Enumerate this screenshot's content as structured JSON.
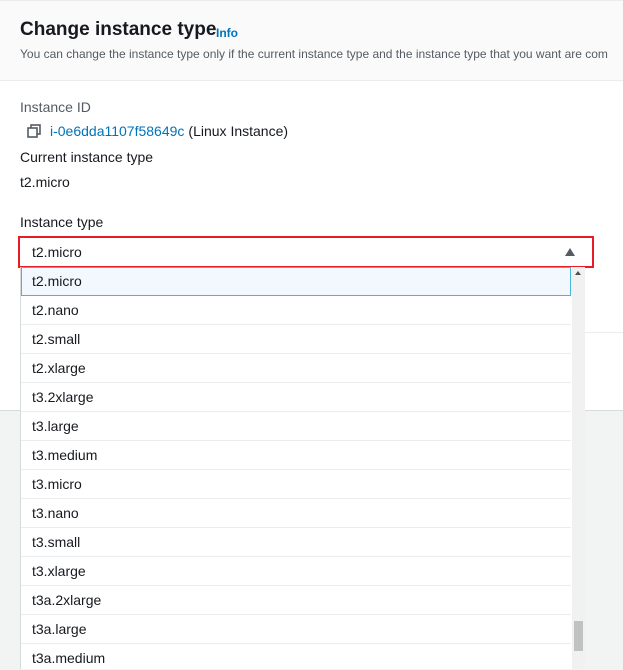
{
  "header": {
    "title": "Change instance type",
    "info_link": "Info",
    "subtitle": "You can change the instance type only if the current instance type and the instance type that you want are com"
  },
  "instance": {
    "id_label": "Instance ID",
    "id_value": "i-0e6dda1107f58649c",
    "id_suffix": "(Linux Instance)",
    "current_type_label": "Current instance type",
    "current_type_value": "t2.micro"
  },
  "instance_type": {
    "label": "Instance type",
    "selected": "t2.micro",
    "options": [
      "t2.micro",
      "t2.nano",
      "t2.small",
      "t2.xlarge",
      "t3.2xlarge",
      "t3.large",
      "t3.medium",
      "t3.micro",
      "t3.nano",
      "t3.small",
      "t3.xlarge",
      "t3a.2xlarge",
      "t3a.large",
      "t3a.medium"
    ]
  },
  "colors": {
    "link": "#0073bb",
    "highlight_border": "#e51e25",
    "option_selected_bg": "#f2f8fd",
    "option_selected_border": "#44b9d6"
  },
  "icons": {
    "copy": "copy-icon",
    "caret": "caret-up-icon"
  }
}
